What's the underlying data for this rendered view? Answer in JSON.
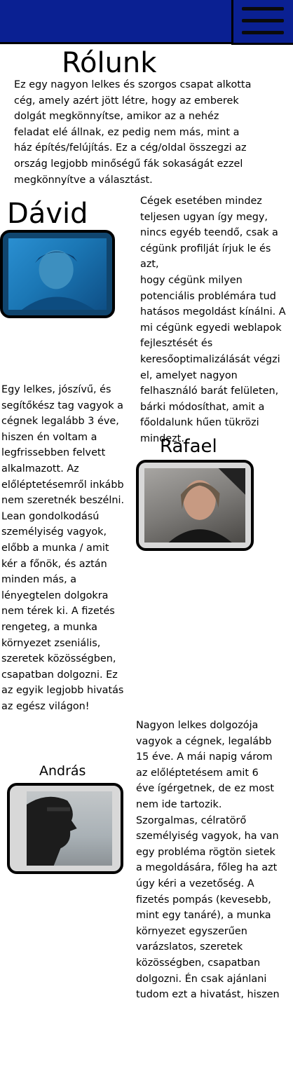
{
  "nav": {
    "menu_icon": "hamburger-menu-icon",
    "bar_color": "#0a2092"
  },
  "about": {
    "title": "Rólunk",
    "lines": [
      "Ez egy nagyon lelkes és szorgos csapat alkotta",
      "cég, amely azért jött létre, hogy az emberek",
      "dolgát megkönnyítse, amikor az a nehéz",
      "feladat elé állnak, ez pedig nem más, mint a",
      "ház építés/felújítás. Ez a cég/oldal összegzi az",
      "ország legjobb minőségű fák sokaságát ezzel",
      "megkönnyítve a választást."
    ]
  },
  "company_text": {
    "lines": [
      "Cégek esetében mindez",
      "teljesen ugyan így megy,",
      "nincs egyéb teendő, csak a",
      "cégünk profilját írjuk le és azt,",
      "hogy cégünk milyen",
      "potenciális problémára tud",
      "hatásos megoldást kínálni. A",
      "mi cégünk egyedi weblapok",
      "fejlesztését és",
      "keresőoptimalizálását végzi",
      "el, amelyet nagyon",
      "felhasználó barát felületen,",
      "bárki módosíthat, amit a",
      "főoldalunk hűen tükrözi",
      "mindezt."
    ]
  },
  "members": [
    {
      "name": "Dávid",
      "photo_bg": "#1b77b5",
      "bio": [
        "Egy lelkes, jószívű, és",
        "segítőkész tag vagyok a",
        "cégnek legalább 3 éve,",
        "hiszen én voltam a",
        "legfrissebben felvett",
        "alkalmazott. Az",
        "előléptetésemről inkább",
        "nem szeretnék beszélni.",
        "Lean gondolkodású",
        "személyiség vagyok,",
        "előbb a munka / amit",
        "kér a főnök, és aztán",
        "minden más, a",
        "lényegtelen dolgokra",
        "nem térek ki. A fizetés",
        "rengeteg, a munka",
        "környezet zseniális,",
        "szeretek közösségben,",
        "csapatban dolgozni.  Ez",
        "az egyik legjobb hivatás",
        "az egész világon!"
      ]
    },
    {
      "name": "Rafael",
      "photo_bg": "#7d7b78",
      "bio": []
    },
    {
      "name": "András",
      "photo_bg": "#a9b1b6",
      "bio": [
        "Nagyon lelkes dolgozója",
        "vagyok a cégnek, legalább",
        "15 éve. A mái napig várom",
        "az előléptetésem amit 6",
        "éve ígérgetnek, de ez most",
        "nem ide tartozik.",
        "Szorgalmas, célratörő",
        "személyiség vagyok, ha van",
        "egy probléma rögtön sietek",
        "a megoldására, főleg ha azt",
        "úgy kéri a vezetőség. A",
        "fizetés pompás (kevesebb,",
        "mint egy tanáré), a munka",
        "környezet egyszerűen",
        "varázslatos, szeretek",
        "közösségben, csapatban",
        "dolgozni. Én csak ajánlani",
        "tudom ezt a hivatást, hiszen"
      ]
    }
  ]
}
